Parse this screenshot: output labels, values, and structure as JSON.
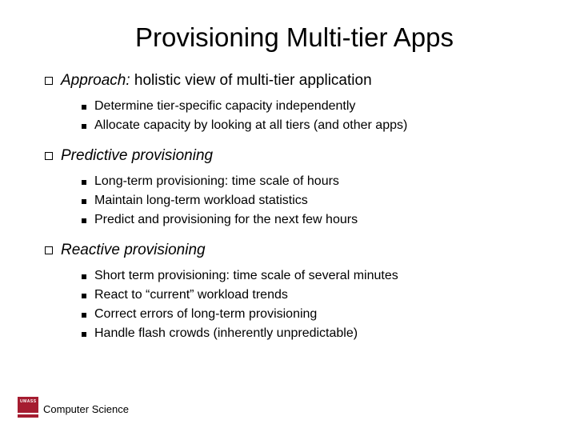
{
  "title": "Provisioning Multi-tier Apps",
  "sections": [
    {
      "heading_prefix": "Approach:",
      "heading_rest": " holistic view of multi-tier application",
      "heading_all_italic": false,
      "items": [
        "Determine tier-specific capacity independently",
        "Allocate capacity by looking at all tiers (and other apps)"
      ]
    },
    {
      "heading_prefix": "Predictive provisioning",
      "heading_rest": "",
      "heading_all_italic": true,
      "items": [
        "Long-term provisioning: time scale of hours",
        "Maintain long-term workload statistics",
        "Predict and provisioning for the next few hours"
      ]
    },
    {
      "heading_prefix": "Reactive provisioning",
      "heading_rest": "",
      "heading_all_italic": true,
      "items": [
        "Short term provisioning: time scale of several minutes",
        "React to “current” workload trends",
        "Correct errors of long-term provisioning",
        "Handle flash crowds (inherently unpredictable)"
      ]
    }
  ],
  "footer": {
    "org": "Computer Science",
    "logo_text": "UMASS"
  }
}
